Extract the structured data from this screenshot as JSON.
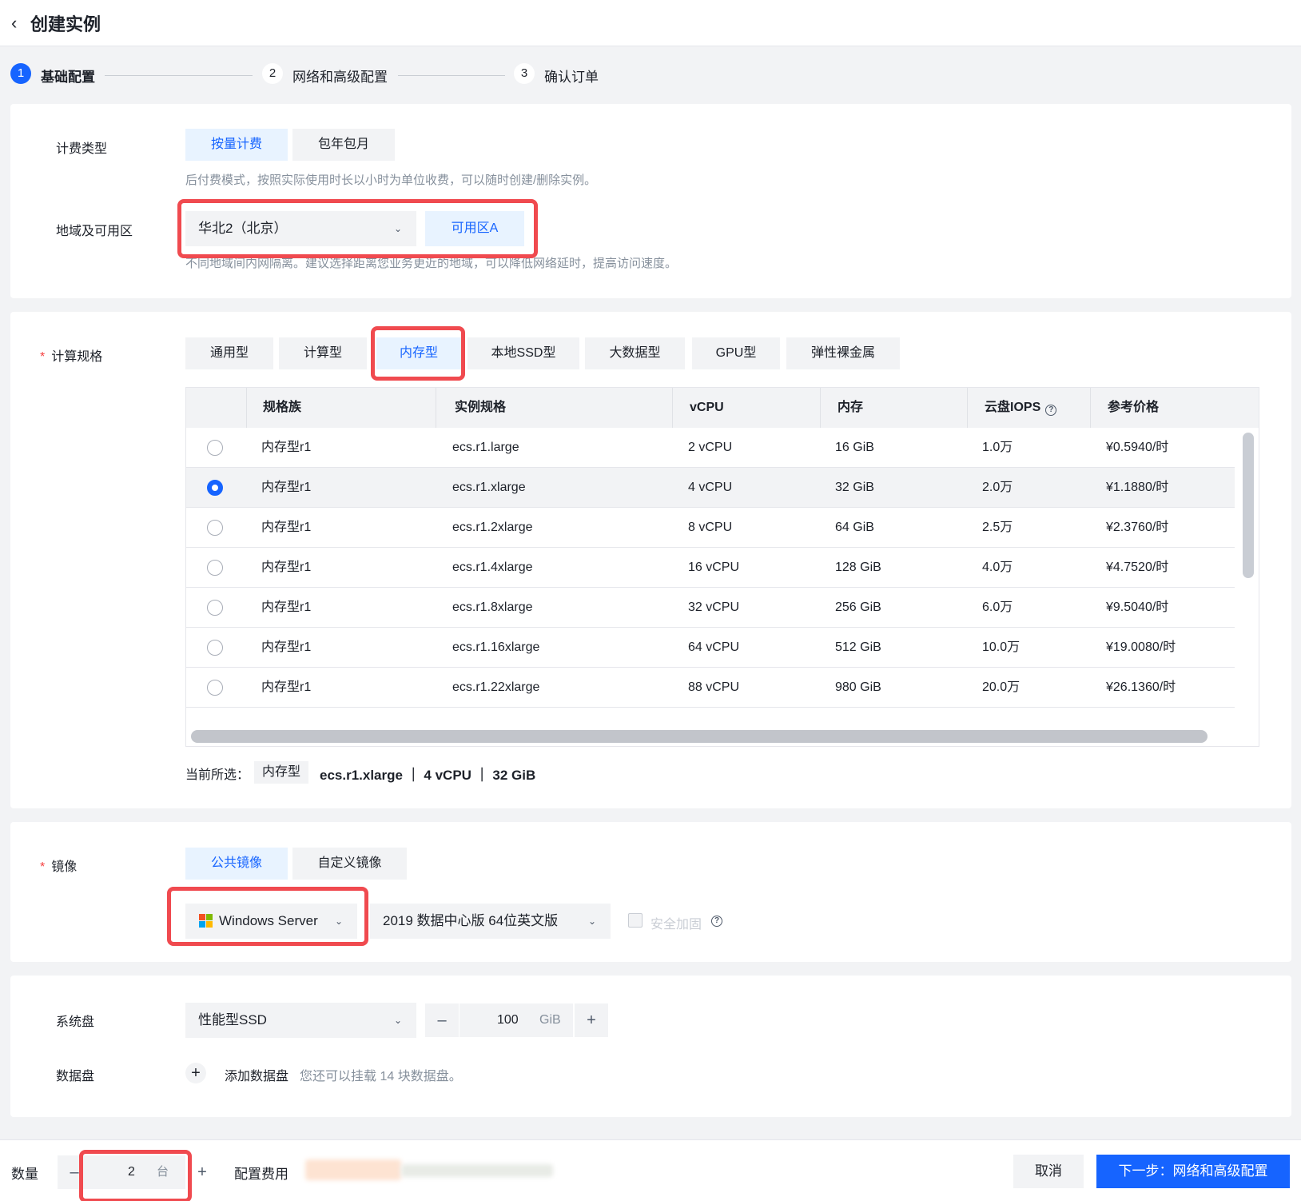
{
  "header": {
    "title": "创建实例"
  },
  "steps": [
    {
      "num": "1",
      "label": "基础配置",
      "active": true
    },
    {
      "num": "2",
      "label": "网络和高级配置",
      "active": false
    },
    {
      "num": "3",
      "label": "确认订单",
      "active": false
    }
  ],
  "billing": {
    "label": "计费类型",
    "options": [
      "按量计费",
      "包年包月"
    ],
    "selected": "按量计费",
    "hint": "后付费模式，按照实际使用时长以小时为单位收费，可以随时创建/删除实例。"
  },
  "region": {
    "label": "地域及可用区",
    "region_value": "华北2（北京）",
    "zone_value": "可用区A",
    "hint": "不同地域间内网隔离。建议选择距离您业务更近的地域，可以降低网络延时，提高访问速度。"
  },
  "compute": {
    "label": "计算规格",
    "tabs": [
      "通用型",
      "计算型",
      "内存型",
      "本地SSD型",
      "大数据型",
      "GPU型",
      "弹性裸金属"
    ],
    "selected_tab": "内存型",
    "columns": [
      "规格族",
      "实例规格",
      "vCPU",
      "内存",
      "云盘IOPS",
      "参考价格"
    ],
    "rows": [
      {
        "family": "内存型r1",
        "spec": "ecs.r1.large",
        "vcpu": "2 vCPU",
        "mem": "16 GiB",
        "iops": "1.0万",
        "price": "¥0.5940/时",
        "selected": false
      },
      {
        "family": "内存型r1",
        "spec": "ecs.r1.xlarge",
        "vcpu": "4 vCPU",
        "mem": "32 GiB",
        "iops": "2.0万",
        "price": "¥1.1880/时",
        "selected": true
      },
      {
        "family": "内存型r1",
        "spec": "ecs.r1.2xlarge",
        "vcpu": "8 vCPU",
        "mem": "64 GiB",
        "iops": "2.5万",
        "price": "¥2.3760/时",
        "selected": false
      },
      {
        "family": "内存型r1",
        "spec": "ecs.r1.4xlarge",
        "vcpu": "16 vCPU",
        "mem": "128 GiB",
        "iops": "4.0万",
        "price": "¥4.7520/时",
        "selected": false
      },
      {
        "family": "内存型r1",
        "spec": "ecs.r1.8xlarge",
        "vcpu": "32 vCPU",
        "mem": "256 GiB",
        "iops": "6.0万",
        "price": "¥9.5040/时",
        "selected": false
      },
      {
        "family": "内存型r1",
        "spec": "ecs.r1.16xlarge",
        "vcpu": "64 vCPU",
        "mem": "512 GiB",
        "iops": "10.0万",
        "price": "¥19.0080/时",
        "selected": false
      },
      {
        "family": "内存型r1",
        "spec": "ecs.r1.22xlarge",
        "vcpu": "88 vCPU",
        "mem": "980 GiB",
        "iops": "20.0万",
        "price": "¥26.1360/时",
        "selected": false
      }
    ],
    "current_label": "当前所选：",
    "current_tag": "内存型",
    "current_summary": "ecs.r1.xlarge ｜ 4 vCPU ｜ 32 GiB"
  },
  "image": {
    "label": "镜像",
    "tabs": [
      "公共镜像",
      "自定义镜像"
    ],
    "selected_tab": "公共镜像",
    "os_value": "Windows Server",
    "version_value": "2019 数据中心版 64位英文版",
    "security_label": "安全加固"
  },
  "disk": {
    "system_label": "系统盘",
    "system_type": "性能型SSD",
    "system_size": "100",
    "system_unit": "GiB",
    "data_label": "数据盘",
    "add_label": "添加数据盘",
    "data_hint": "您还可以挂载 14 块数据盘。"
  },
  "footer": {
    "qty_label": "数量",
    "qty_value": "2",
    "qty_unit": "台",
    "fee_label": "配置费用",
    "cancel_label": "取消",
    "next_label": "下一步：网络和高级配置"
  },
  "colors": {
    "primary": "#1664ff",
    "highlight": "#f04a4f"
  }
}
